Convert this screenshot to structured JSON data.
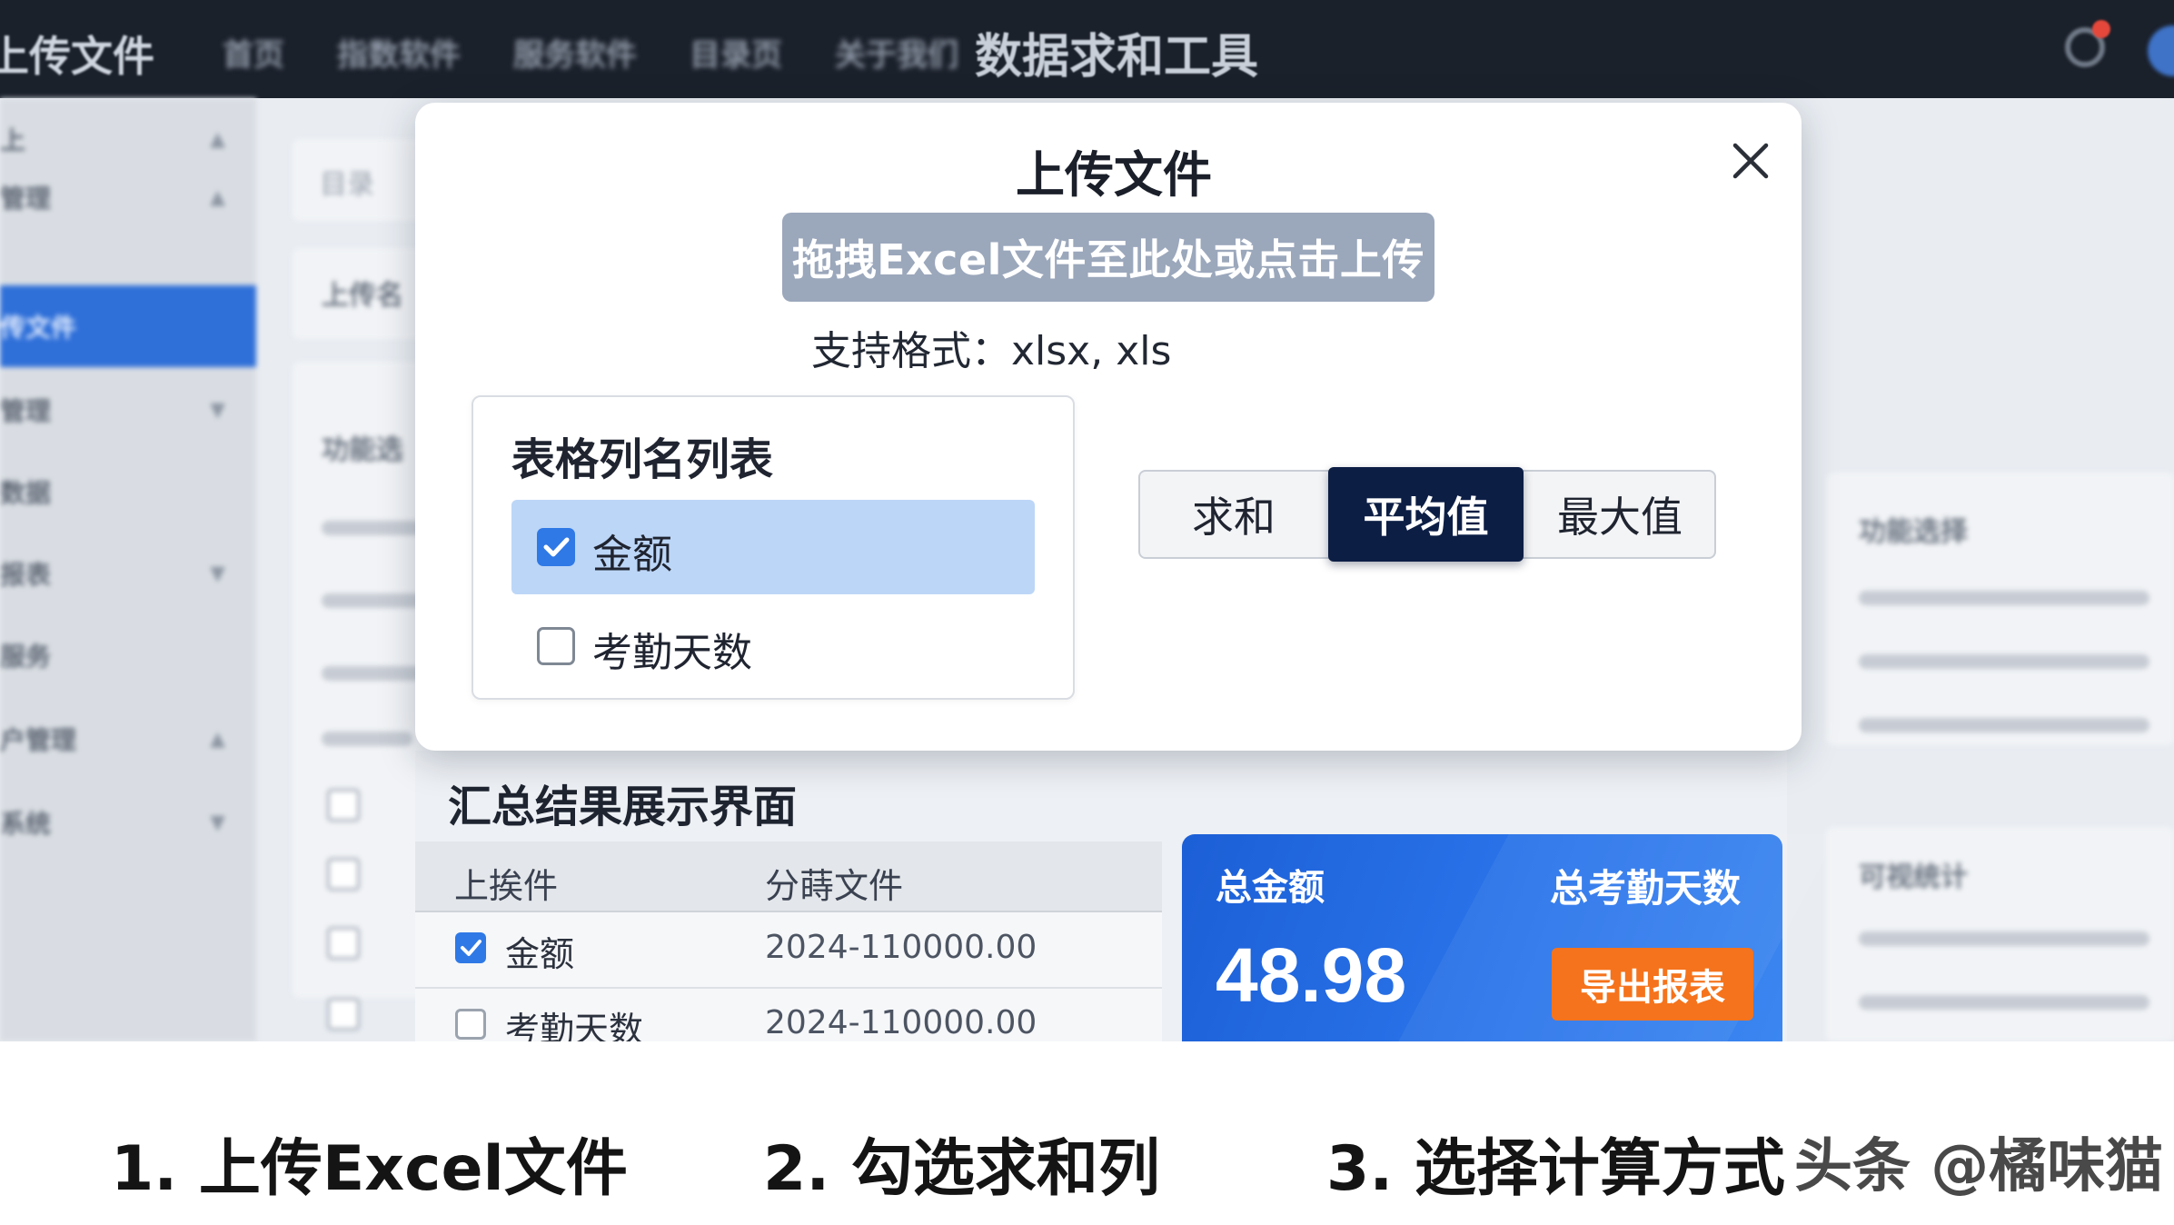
{
  "topbar": {
    "brand": "上传文件",
    "nav": [
      "首页",
      "指数软件",
      "服务软件",
      "目录页",
      "关于我们"
    ],
    "title": "数据求和工具"
  },
  "sidebar": {
    "items": [
      {
        "label": "上",
        "arrow": "▲"
      },
      {
        "label": "管理",
        "arrow": "▲"
      },
      {
        "label": "传文件",
        "arrow": ""
      },
      {
        "label": "管理",
        "arrow": "▼"
      },
      {
        "label": "数据",
        "arrow": ""
      },
      {
        "label": "报表",
        "arrow": "▼"
      },
      {
        "label": "服务",
        "arrow": ""
      },
      {
        "label": "户管理",
        "arrow": "▲"
      },
      {
        "label": "系统",
        "arrow": "▼"
      }
    ]
  },
  "background": {
    "search_placeholder": "目录",
    "upload_tab": "上传名",
    "func_section": "功能选",
    "right_func": "功能选择",
    "right_stats": "可视统计"
  },
  "modal": {
    "title": "上传文件",
    "upload_zone": "拖拽Excel文件至此处或点击上传",
    "formats": "支持格式：xlsx, xls",
    "columns_title": "表格列名列表",
    "columns": [
      {
        "label": "金额",
        "checked": true
      },
      {
        "label": "考勤天数",
        "checked": false
      }
    ],
    "calc_modes": [
      {
        "label": "求和",
        "active": false
      },
      {
        "label": "平均值",
        "active": true
      },
      {
        "label": "最大值",
        "active": false
      }
    ]
  },
  "summary": {
    "title": "汇总结果展示界面",
    "headers": [
      "上挨件",
      "分蒔文件"
    ],
    "rows": [
      {
        "name": "金额",
        "value": "2024-110000.00",
        "checked": true
      },
      {
        "name": "考勤天数",
        "value": "2024-110000.00",
        "checked": false
      }
    ],
    "card": {
      "label_total": "总金额",
      "label_days": "总考勤天数",
      "value": "48.98",
      "export": "导出报表"
    }
  },
  "steps": [
    "1. 上传Excel文件",
    "2. 勾选求和列",
    "3. 选择计算方式"
  ],
  "watermark": "头条 @橘味猫",
  "colors": {
    "accent": "#2f79e6",
    "active_segment": "#0d1e45",
    "export_button": "#f5731c",
    "upload_zone": "#9ba7bb"
  }
}
